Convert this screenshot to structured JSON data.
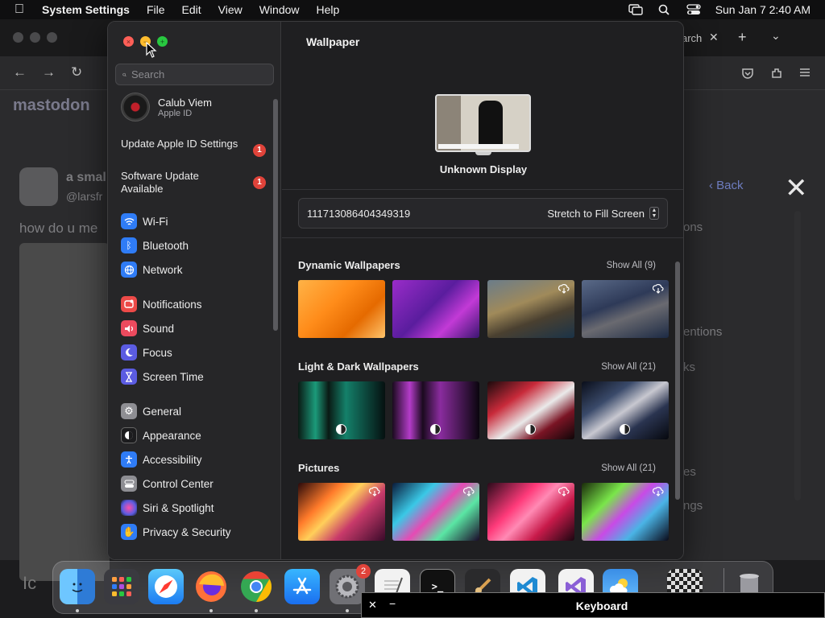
{
  "menubar": {
    "app_name": "System Settings",
    "menus": [
      "File",
      "Edit",
      "View",
      "Window",
      "Help"
    ],
    "clock": "Sun Jan 7  2:40 AM"
  },
  "browser": {
    "tab_search_fragment": "arch",
    "site_name": "mastodon",
    "post_author_fragment": "a smal",
    "post_handle_fragment": "@larsfr",
    "post_text_fragment": "how do u me",
    "back_label": "Back",
    "right_fragments": [
      "ons",
      "entions",
      "ks",
      "es",
      "ngs"
    ],
    "bottom_left_fragment": "Ic"
  },
  "settings": {
    "search_placeholder": "Search",
    "user": {
      "name": "Calub Viem",
      "subtitle": "Apple ID"
    },
    "alerts": [
      {
        "label": "Update Apple ID Settings",
        "count": "1"
      },
      {
        "label": "Software Update Available",
        "count": "1"
      }
    ],
    "nav_groups": [
      [
        {
          "label": "Wi-Fi",
          "icon": "wifi-icon",
          "color": "#2f7cf6"
        },
        {
          "label": "Bluetooth",
          "icon": "bluetooth-icon",
          "color": "#2f7cf6"
        },
        {
          "label": "Network",
          "icon": "network-icon",
          "color": "#2f7cf6"
        }
      ],
      [
        {
          "label": "Notifications",
          "icon": "notifications-icon",
          "color": "#ec4a48"
        },
        {
          "label": "Sound",
          "icon": "sound-icon",
          "color": "#ec4a5e"
        },
        {
          "label": "Focus",
          "icon": "focus-icon",
          "color": "#5b5ce2"
        },
        {
          "label": "Screen Time",
          "icon": "screen-time-icon",
          "color": "#5b5ce2"
        }
      ],
      [
        {
          "label": "General",
          "icon": "gear-icon",
          "color": "#8e8e93"
        },
        {
          "label": "Appearance",
          "icon": "appearance-icon",
          "color": "#1c1c1e"
        },
        {
          "label": "Accessibility",
          "icon": "accessibility-icon",
          "color": "#2f7cf6"
        },
        {
          "label": "Control Center",
          "icon": "control-center-icon",
          "color": "#8e8e93"
        },
        {
          "label": "Siri & Spotlight",
          "icon": "siri-icon",
          "color": "#b04de0"
        },
        {
          "label": "Privacy & Security",
          "icon": "hand-icon",
          "color": "#2f7cf6"
        }
      ]
    ]
  },
  "wallpaper": {
    "title": "Wallpaper",
    "display_name": "Unknown Display",
    "current_name": "111713086404349319",
    "fit_mode": "Stretch to Fill Screen",
    "sections": [
      {
        "title": "Dynamic Wallpapers",
        "show_all": "Show All (9)"
      },
      {
        "title": "Light & Dark Wallpapers",
        "show_all": "Show All (21)"
      },
      {
        "title": "Pictures",
        "show_all": "Show All (21)"
      }
    ]
  },
  "dock": {
    "settings_badge": "2"
  },
  "keyboard": {
    "title": "Keyboard"
  }
}
